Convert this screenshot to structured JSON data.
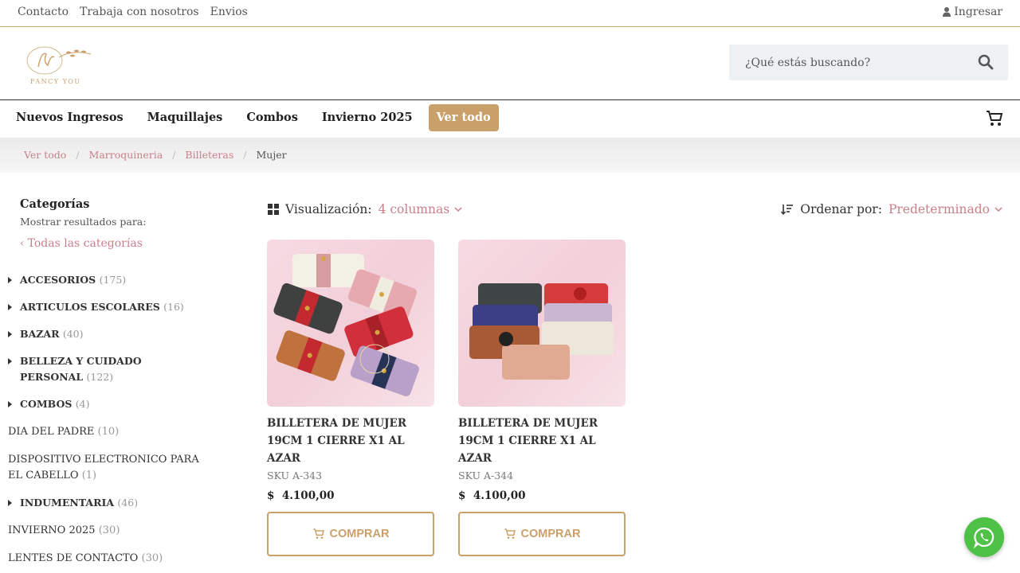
{
  "topbar": {
    "links": [
      "Contacto",
      "Trabaja con nosotros",
      "Envios"
    ],
    "login_label": "Ingresar"
  },
  "header": {
    "logo_text": "FANCY YOU",
    "search_placeholder": "¿Qué estás buscando?"
  },
  "nav": {
    "items": [
      "Nuevos Ingresos",
      "Maquillajes",
      "Combos",
      "Invierno 2025"
    ],
    "highlight": "Ver todo"
  },
  "breadcrumb": {
    "links": [
      "Ver todo",
      "Marroquineria",
      "Billeteras"
    ],
    "current": "Mujer",
    "separator": "/"
  },
  "sidebar": {
    "title": "Categorías",
    "subtitle": "Mostrar resultados para:",
    "back_label": "Todas las categorías",
    "categories": [
      {
        "name": "ACCESORIOS",
        "count": "(175)"
      },
      {
        "name": "ARTICULOS ESCOLARES",
        "count": "(16)"
      },
      {
        "name": "BAZAR",
        "count": "(40)"
      },
      {
        "name": "BELLEZA Y CUIDADO PERSONAL",
        "count": "(122)"
      },
      {
        "name": "COMBOS",
        "count": "(4)"
      },
      {
        "name": "DIA DEL PADRE",
        "count": "(10)"
      },
      {
        "name": "DISPOSITIVO ELECTRONICO PARA EL CABELLO",
        "count": "(1)"
      },
      {
        "name": "INDUMENTARIA",
        "count": "(46)"
      },
      {
        "name": "INVIERNO 2025",
        "count": "(30)"
      },
      {
        "name": "LENTES DE CONTACTO",
        "count": "(30)"
      }
    ]
  },
  "toolbar": {
    "view_label": "Visualización:",
    "view_value": "4 columnas",
    "sort_label": "Ordenar por:",
    "sort_value": "Predeterminado"
  },
  "products": [
    {
      "name": "BILLETERA DE MUJER 19CM 1 CIERRE X1 AL AZAR",
      "sku": "SKU A-343",
      "currency": "$",
      "price": "4.100,00",
      "buy_label": "COMPRAR"
    },
    {
      "name": "BILLETERA DE MUJER 19CM 1 CIERRE X1 AL AZAR",
      "sku": "SKU A-344",
      "currency": "$",
      "price": "4.100,00",
      "buy_label": "COMPRAR"
    }
  ],
  "colors": {
    "gold": "#c9a06a",
    "rose": "#c9808a",
    "whatsapp": "#4dc247"
  }
}
